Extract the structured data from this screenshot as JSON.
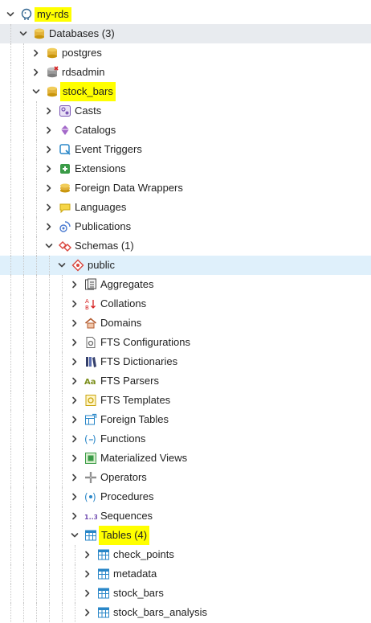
{
  "colors": {
    "highlight": "#ffff00",
    "selected_row": "#e8ebef",
    "active_row": "#dff0fb"
  },
  "tree": [
    {
      "label": "my-rds",
      "name": "server-my-rds",
      "icon": "elephant-icon",
      "expanded": true,
      "depth": 0,
      "highlight": true
    },
    {
      "label": "Databases",
      "count": "(3)",
      "name": "databases-node",
      "icon": "databases-icon",
      "expanded": true,
      "depth": 1,
      "selected": true
    },
    {
      "label": "postgres",
      "name": "db-postgres",
      "icon": "database-icon",
      "expanded": false,
      "depth": 2
    },
    {
      "label": "rdsadmin",
      "name": "db-rdsadmin",
      "icon": "database-disconnected-icon",
      "expanded": false,
      "depth": 2
    },
    {
      "label": "stock_bars",
      "name": "db-stock-bars",
      "icon": "database-icon",
      "expanded": true,
      "depth": 2,
      "highlight": true,
      "tall": true
    },
    {
      "label": "Casts",
      "name": "casts-node",
      "icon": "casts-icon",
      "expanded": false,
      "depth": 3
    },
    {
      "label": "Catalogs",
      "name": "catalogs-node",
      "icon": "catalogs-icon",
      "expanded": false,
      "depth": 3
    },
    {
      "label": "Event Triggers",
      "name": "event-triggers-node",
      "icon": "event-trigger-icon",
      "expanded": false,
      "depth": 3
    },
    {
      "label": "Extensions",
      "name": "extensions-node",
      "icon": "extension-icon",
      "expanded": false,
      "depth": 3
    },
    {
      "label": "Foreign Data Wrappers",
      "name": "foreign-data-wrappers-node",
      "icon": "foreign-data-wrapper-icon",
      "expanded": false,
      "depth": 3
    },
    {
      "label": "Languages",
      "name": "languages-node",
      "icon": "language-icon",
      "expanded": false,
      "depth": 3
    },
    {
      "label": "Publications",
      "name": "publications-node",
      "icon": "publication-icon",
      "expanded": false,
      "depth": 3
    },
    {
      "label": "Schemas",
      "count": "(1)",
      "name": "schemas-node",
      "icon": "schemas-icon",
      "expanded": true,
      "depth": 3
    },
    {
      "label": "public",
      "name": "schema-public",
      "icon": "schema-icon",
      "expanded": true,
      "depth": 4,
      "active": true
    },
    {
      "label": "Aggregates",
      "name": "aggregates-node",
      "icon": "aggregate-icon",
      "expanded": false,
      "depth": 5
    },
    {
      "label": "Collations",
      "name": "collations-node",
      "icon": "collation-icon",
      "expanded": false,
      "depth": 5
    },
    {
      "label": "Domains",
      "name": "domains-node",
      "icon": "domain-icon",
      "expanded": false,
      "depth": 5
    },
    {
      "label": "FTS Configurations",
      "name": "fts-configurations-node",
      "icon": "fts-configuration-icon",
      "expanded": false,
      "depth": 5
    },
    {
      "label": "FTS Dictionaries",
      "name": "fts-dictionaries-node",
      "icon": "fts-dictionary-icon",
      "expanded": false,
      "depth": 5
    },
    {
      "label": "FTS Parsers",
      "name": "fts-parsers-node",
      "icon": "fts-parser-icon",
      "expanded": false,
      "depth": 5
    },
    {
      "label": "FTS Templates",
      "name": "fts-templates-node",
      "icon": "fts-template-icon",
      "expanded": false,
      "depth": 5
    },
    {
      "label": "Foreign Tables",
      "name": "foreign-tables-node",
      "icon": "foreign-table-icon",
      "expanded": false,
      "depth": 5
    },
    {
      "label": "Functions",
      "name": "functions-node",
      "icon": "function-icon",
      "expanded": false,
      "depth": 5
    },
    {
      "label": "Materialized Views",
      "name": "materialized-views-node",
      "icon": "materialized-view-icon",
      "expanded": false,
      "depth": 5
    },
    {
      "label": "Operators",
      "name": "operators-node",
      "icon": "operator-icon",
      "expanded": false,
      "depth": 5
    },
    {
      "label": "Procedures",
      "name": "procedures-node",
      "icon": "procedure-icon",
      "expanded": false,
      "depth": 5
    },
    {
      "label": "Sequences",
      "name": "sequences-node",
      "icon": "sequence-icon",
      "expanded": false,
      "depth": 5
    },
    {
      "label": "Tables",
      "count": "(4)",
      "name": "tables-node",
      "icon": "tables-icon",
      "expanded": true,
      "depth": 5,
      "highlight": true,
      "tall": true
    },
    {
      "label": "check_points",
      "name": "table-check-points",
      "icon": "table-icon",
      "expanded": false,
      "depth": 6
    },
    {
      "label": "metadata",
      "name": "table-metadata",
      "icon": "table-icon",
      "expanded": false,
      "depth": 6
    },
    {
      "label": "stock_bars",
      "name": "table-stock-bars",
      "icon": "table-icon",
      "expanded": false,
      "depth": 6
    },
    {
      "label": "stock_bars_analysis",
      "name": "table-stock-bars-analysis",
      "icon": "table-icon",
      "expanded": false,
      "depth": 6
    }
  ]
}
